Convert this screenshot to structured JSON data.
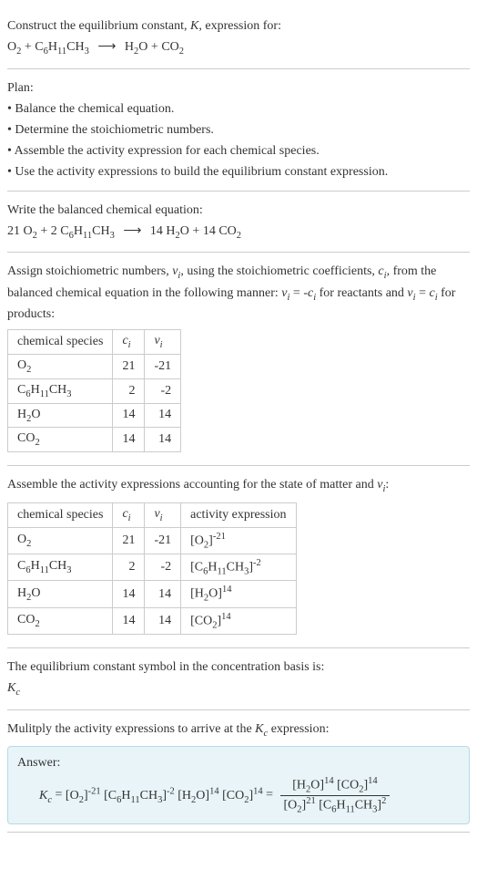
{
  "intro": {
    "line1": "Construct the equilibrium constant, K, expression for:",
    "equation_lhs1": "O₂",
    "equation_plus": " + ",
    "equation_lhs2": "C₆H₁₁CH₃",
    "equation_arrow": "⟶",
    "equation_rhs1": "H₂O",
    "equation_rhs2": "CO₂"
  },
  "plan": {
    "title": "Plan:",
    "b1": "• Balance the chemical equation.",
    "b2": "• Determine the stoichiometric numbers.",
    "b3": "• Assemble the activity expression for each chemical species.",
    "b4": "• Use the activity expressions to build the equilibrium constant expression."
  },
  "balanced": {
    "title": "Write the balanced chemical equation:",
    "c1": "21",
    "s1": "O₂",
    "plus1": " + ",
    "c2": "2",
    "s2": "C₆H₁₁CH₃",
    "arrow": "⟶",
    "c3": "14",
    "s3": "H₂O",
    "plus2": " + ",
    "c4": "14",
    "s4": "CO₂"
  },
  "stoich_text": {
    "line": "Assign stoichiometric numbers, νᵢ, using the stoichiometric coefficients, cᵢ, from the balanced chemical equation in the following manner: νᵢ = -cᵢ for reactants and νᵢ = cᵢ for products:"
  },
  "table1": {
    "h1": "chemical species",
    "h2": "cᵢ",
    "h3": "νᵢ",
    "r1c1": "O₂",
    "r1c2": "21",
    "r1c3": "-21",
    "r2c1": "C₆H₁₁CH₃",
    "r2c2": "2",
    "r2c3": "-2",
    "r3c1": "H₂O",
    "r3c2": "14",
    "r3c3": "14",
    "r4c1": "CO₂",
    "r4c2": "14",
    "r4c3": "14"
  },
  "activity_text": "Assemble the activity expressions accounting for the state of matter and νᵢ:",
  "table2": {
    "h1": "chemical species",
    "h2": "cᵢ",
    "h3": "νᵢ",
    "h4": "activity expression",
    "r1c1": "O₂",
    "r1c2": "21",
    "r1c3": "-21",
    "r1c4_base": "[O₂]",
    "r1c4_exp": "-21",
    "r2c1": "C₆H₁₁CH₃",
    "r2c2": "2",
    "r2c3": "-2",
    "r2c4_base": "[C₆H₁₁CH₃]",
    "r2c4_exp": "-2",
    "r3c1": "H₂O",
    "r3c2": "14",
    "r3c3": "14",
    "r3c4_base": "[H₂O]",
    "r3c4_exp": "14",
    "r4c1": "CO₂",
    "r4c2": "14",
    "r4c3": "14",
    "r4c4_base": "[CO₂]",
    "r4c4_exp": "14"
  },
  "symbol_text": {
    "line1": "The equilibrium constant symbol in the concentration basis is:",
    "line2": "K_c"
  },
  "multiply_text": "Mulitply the activity expressions to arrive at the K_c expression:",
  "answer": {
    "label": "Answer:",
    "kc": "K_c",
    "eq": " = ",
    "t1_base": "[O₂]",
    "t1_exp": "-21",
    "t2_base": "[C₆H₁₁CH₃]",
    "t2_exp": "-2",
    "t3_base": "[H₂O]",
    "t3_exp": "14",
    "t4_base": "[CO₂]",
    "t4_exp": "14",
    "eq2": " = ",
    "num1_base": "[H₂O]",
    "num1_exp": "14",
    "num2_base": "[CO₂]",
    "num2_exp": "14",
    "den1_base": "[O₂]",
    "den1_exp": "21",
    "den2_base": "[C₆H₁₁CH₃]",
    "den2_exp": "2"
  }
}
